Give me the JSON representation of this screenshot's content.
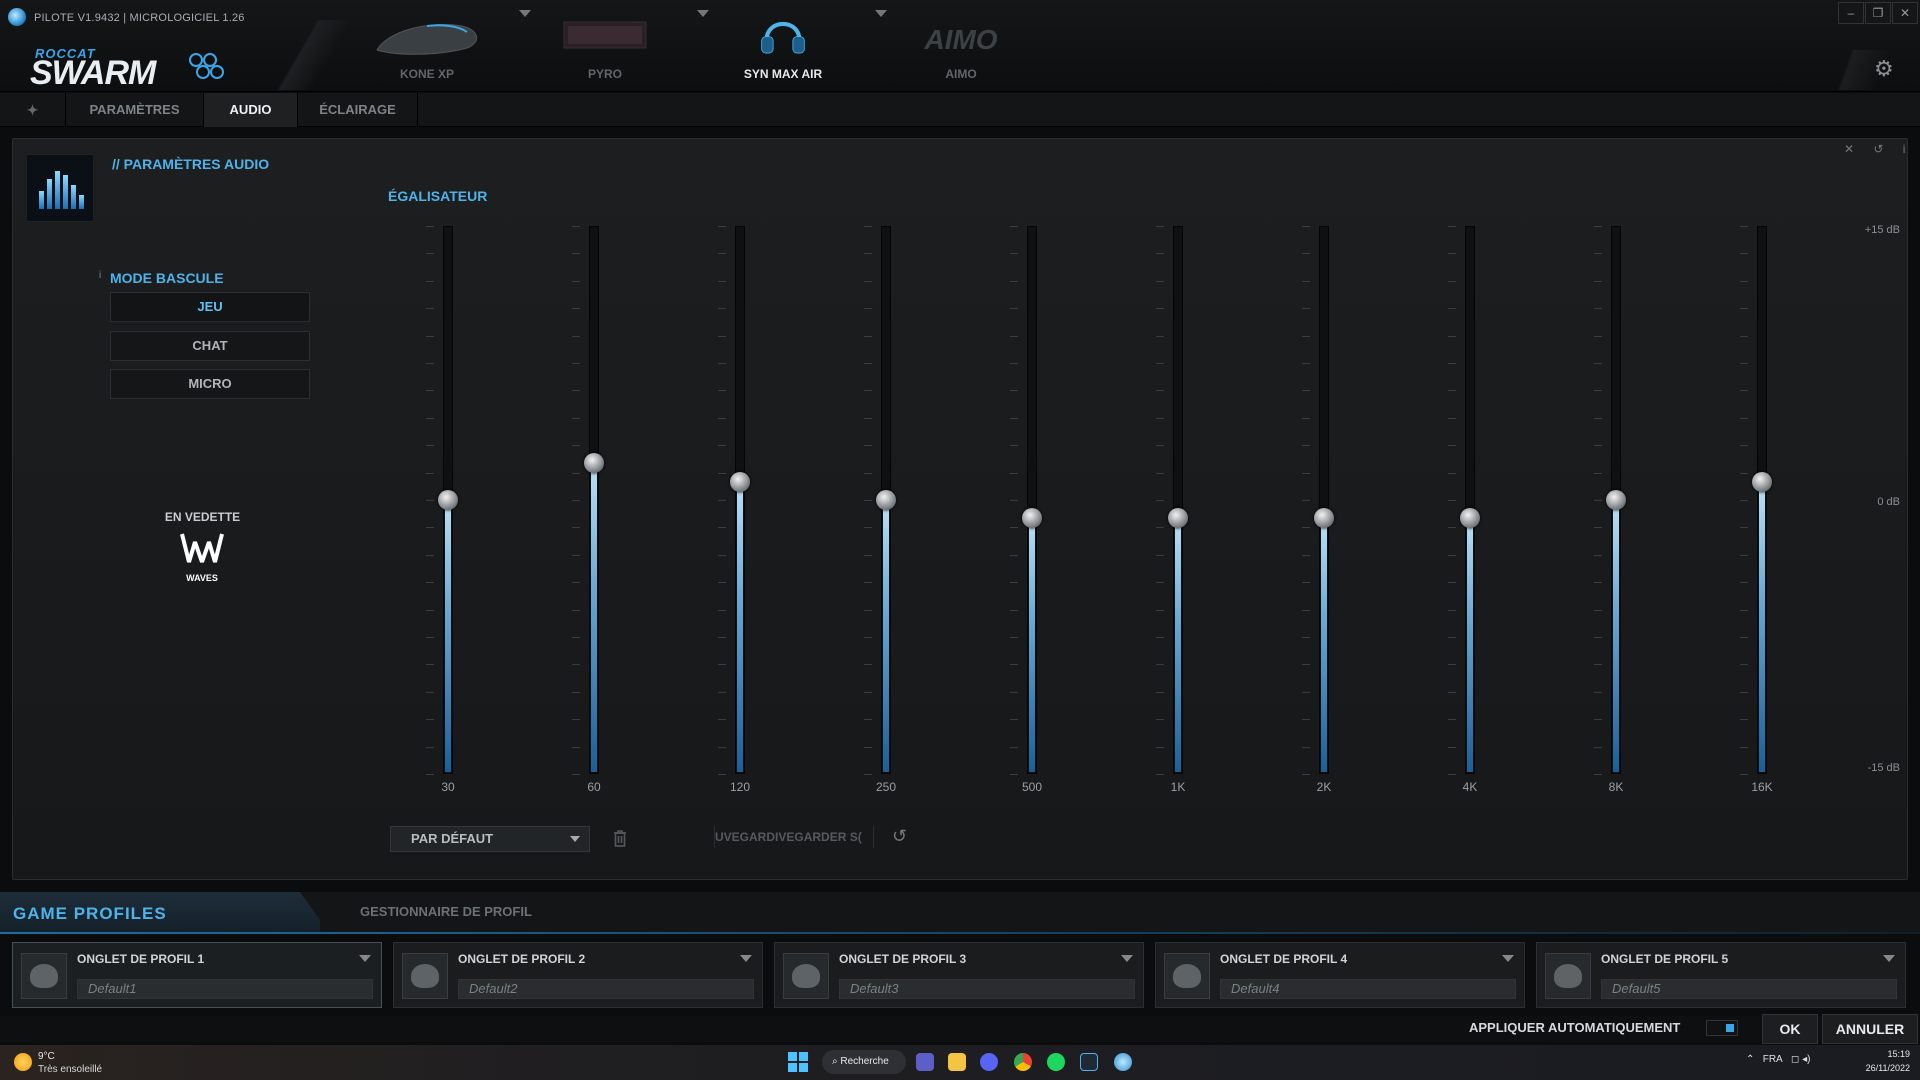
{
  "window": {
    "title": "PILOTE V1.9432 | MICROLOGICIEL 1.26",
    "controls": [
      "–",
      "❐",
      "✕"
    ]
  },
  "brand": {
    "top": "ROCCAT",
    "main": "SWARM"
  },
  "devices": [
    {
      "label": "KONE XP",
      "active": false
    },
    {
      "label": "PYRO",
      "active": false
    },
    {
      "label": "SYN MAX AIR",
      "active": true
    },
    {
      "label": "AIMO",
      "active": false
    }
  ],
  "aimo_logo": "AIMO",
  "tabs": [
    {
      "label": "PARAMÈTRES",
      "active": false
    },
    {
      "label": "AUDIO",
      "active": true
    },
    {
      "label": "ÉCLAIRAGE",
      "active": false
    }
  ],
  "audio": {
    "section_title": "// PARAMÈTRES AUDIO",
    "mode_title": "MODE BASCULE",
    "mode_info": "i",
    "modes": [
      {
        "label": "JEU",
        "selected": true
      },
      {
        "label": "CHAT",
        "selected": false
      },
      {
        "label": "MICRO",
        "selected": false
      }
    ],
    "featured_label": "EN VEDETTE",
    "waves_label": "WAVES",
    "panel_tools": "✕ ↺ i"
  },
  "equalizer": {
    "title": "ÉGALISATEUR",
    "db_max_label": "+15 dB",
    "db_mid_label": "0 dB",
    "db_min_label": "-15 dB",
    "range_db": [
      -15,
      15
    ],
    "bands": [
      {
        "freq": "30",
        "gain_db": 0
      },
      {
        "freq": "60",
        "gain_db": 2
      },
      {
        "freq": "120",
        "gain_db": 1
      },
      {
        "freq": "250",
        "gain_db": 0
      },
      {
        "freq": "500",
        "gain_db": -1
      },
      {
        "freq": "1K",
        "gain_db": -1
      },
      {
        "freq": "2K",
        "gain_db": -1
      },
      {
        "freq": "4K",
        "gain_db": -1
      },
      {
        "freq": "8K",
        "gain_db": 0
      },
      {
        "freq": "16K",
        "gain_db": 1
      }
    ],
    "preset_value": "PAR DÉFAUT",
    "save_text_left": "UVEGARD",
    "save_text_right": "IVEGARDER S("
  },
  "profiles": {
    "title": "GAME PROFILES",
    "manager_label": "GESTIONNAIRE DE PROFIL",
    "items": [
      {
        "name": "ONGLET DE PROFIL 1",
        "value": "Default1",
        "active": true
      },
      {
        "name": "ONGLET DE PROFIL 2",
        "value": "Default2",
        "active": false
      },
      {
        "name": "ONGLET DE PROFIL 3",
        "value": "Default3",
        "active": false
      },
      {
        "name": "ONGLET DE PROFIL 4",
        "value": "Default4",
        "active": false
      },
      {
        "name": "ONGLET DE PROFIL 5",
        "value": "Default5",
        "active": false
      }
    ]
  },
  "footer": {
    "auto_apply_label": "APPLIQUER AUTOMATIQUEMENT",
    "ok_label": "OK",
    "cancel_label": "ANNULER"
  },
  "taskbar": {
    "weather_temp": "9°C",
    "weather_desc": "Très ensoleillé",
    "search_label": "Recherche",
    "language": "FRA",
    "time": "15:19",
    "date": "26/11/2022"
  },
  "colors": {
    "accent": "#4fb3ea",
    "background": "#1a1c1e"
  }
}
